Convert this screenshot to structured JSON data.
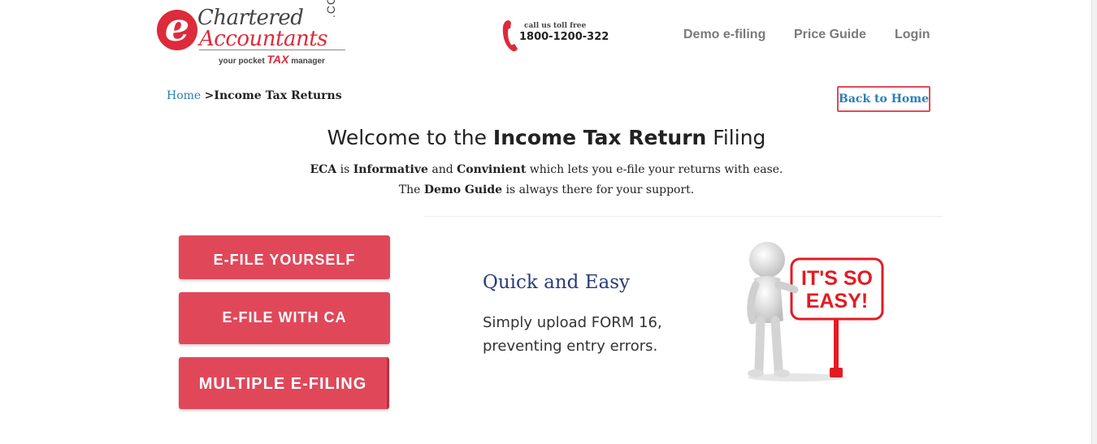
{
  "brand": {
    "logo_letter": "e",
    "logo_line1": "Chartered",
    "logo_line2": "Accountants",
    "logo_suffix": ".COM",
    "tagline_pre": "your pocket ",
    "tagline_tax": "TAX",
    "tagline_post": " manager",
    "accent_color": "#dc2b3a"
  },
  "contact": {
    "label": "call us toll free",
    "number": "1800-1200-322",
    "icon": "phone-icon"
  },
  "nav": {
    "demo": "Demo e-filing",
    "price": "Price Guide",
    "login": "Login"
  },
  "breadcrumb": {
    "home": "Home",
    "separator": ">",
    "current": "Income Tax Returns"
  },
  "back_home": "Back to Home",
  "welcome": {
    "pre": "Welcome to the ",
    "bold": "Income Tax Return",
    "post": " Filing"
  },
  "intro": {
    "l1_b1": "ECA",
    "l1_t1": " is ",
    "l1_b2": "Informative",
    "l1_t2": " and ",
    "l1_b3": "Convinient",
    "l1_t3": " which lets you e-file your returns with ease.",
    "l2_t1": "The ",
    "l2_b1": "Demo Guide",
    "l2_t2": " is always there for your support."
  },
  "buttons": {
    "efile_yourself": "E-FILE YOURSELF",
    "efile_ca": "E-FILE WITH CA",
    "multiple": "MULTIPLE E-FILING",
    "color": "#e0485a"
  },
  "feature": {
    "title": "Quick and Easy",
    "line1": "Simply upload FORM 16,",
    "line2": "preventing entry errors."
  },
  "illustration": {
    "sign_line1": "IT'S SO",
    "sign_line2": "EASY!"
  }
}
